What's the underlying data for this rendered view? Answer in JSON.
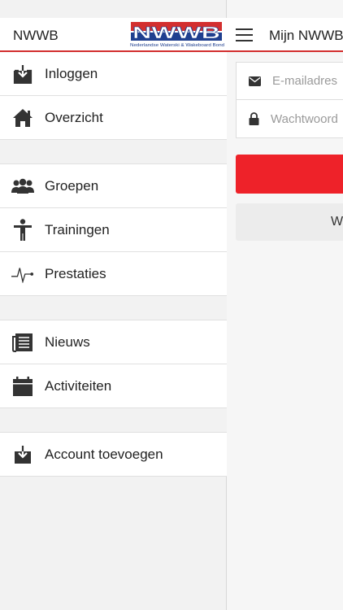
{
  "drawer": {
    "title": "NWWB",
    "logo": {
      "text": "NWWB",
      "subtitle": "Nederlandse Waterski & Wakeboard Bond",
      "colors": [
        "#d32f2f",
        "#1f3f8f"
      ]
    },
    "items": [
      {
        "label": "Inloggen",
        "icon": "login-icon"
      },
      {
        "label": "Overzicht",
        "icon": "home-icon"
      },
      {
        "label": "Groepen",
        "icon": "groups-icon"
      },
      {
        "label": "Trainingen",
        "icon": "person-icon"
      },
      {
        "label": "Prestaties",
        "icon": "heartbeat-icon"
      },
      {
        "label": "Nieuws",
        "icon": "news-icon"
      },
      {
        "label": "Activiteiten",
        "icon": "calendar-icon"
      },
      {
        "label": "Account toevoegen",
        "icon": "add-account-icon"
      }
    ]
  },
  "main": {
    "title": "Mijn NWWB",
    "email_placeholder": "E-mailadres",
    "password_placeholder": "Wachtwoord",
    "secondary_button_label": "W"
  },
  "colors": {
    "accent_red": "#ee2229",
    "header_line": "#d32f2f",
    "status_green": "#4cd964"
  }
}
